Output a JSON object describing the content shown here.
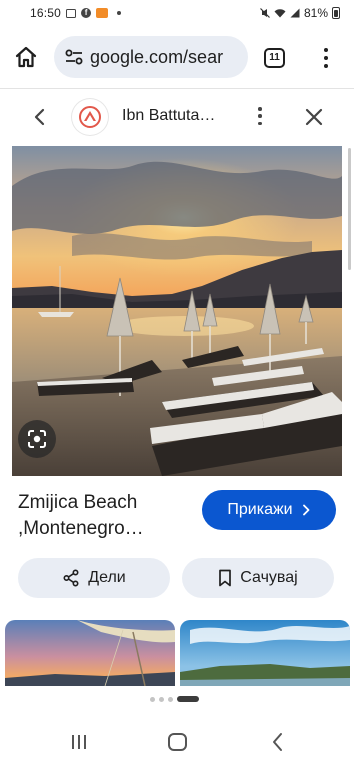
{
  "status_bar": {
    "time": "16:50",
    "battery": "81%",
    "fb_glyph": "f"
  },
  "browser": {
    "url": "google.com/sear",
    "tab_count": "11",
    "icons": {
      "home": "home-icon",
      "site_settings": "tune-icon",
      "menu": "more-vert-icon"
    }
  },
  "panel": {
    "site_title": "Ibn Battuta…",
    "icons": {
      "back": "chevron-left-icon",
      "menu": "more-vert-icon",
      "close": "close-icon"
    }
  },
  "image": {
    "lens_icon": "google-lens-icon"
  },
  "caption": {
    "line1": "Zmijica Beach",
    "line2": ",Montenegro…"
  },
  "visit_button": {
    "label": "Прикажи",
    "icon": "chevron-right-icon"
  },
  "actions": {
    "share_label": "Дели",
    "save_label": "Сачувај"
  },
  "pager": {
    "total_pages": 4,
    "active_index": 3
  },
  "colors": {
    "accent": "#0b57d0",
    "pill_bg": "#e9edf4",
    "logo_red": "#e2584b"
  }
}
